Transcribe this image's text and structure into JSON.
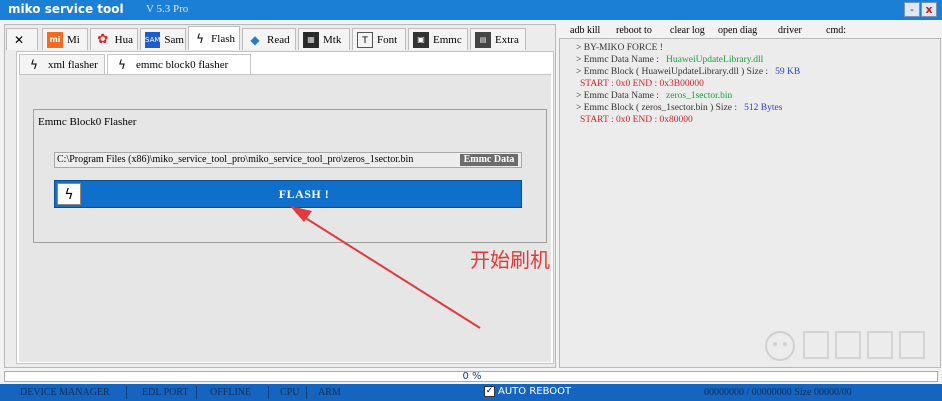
{
  "window": {
    "title": "miko service tool",
    "version": "V 5.3 Pro",
    "minimize_glyph": "-",
    "close_glyph": "x"
  },
  "tabs": [
    {
      "label": "",
      "icon": "tools-icon"
    },
    {
      "label": "Mi",
      "icon": "mi-logo"
    },
    {
      "label": "Hua",
      "icon": "huawei-logo"
    },
    {
      "label": "Sam",
      "icon": "samsung-logo"
    },
    {
      "label": "Flash",
      "icon": "flash-icon"
    },
    {
      "label": "Read",
      "icon": "read-icon"
    },
    {
      "label": "Mtk",
      "icon": "mtk-chip-icon"
    },
    {
      "label": "Font",
      "icon": "font-icon"
    },
    {
      "label": "Emmc",
      "icon": "emmc-chip-icon"
    },
    {
      "label": "Extra",
      "icon": "extra-icon"
    }
  ],
  "subtabs": [
    {
      "label": "xml flasher"
    },
    {
      "label": "emmc block0 flasher"
    }
  ],
  "flasher": {
    "group_title": "Emmc Block0 Flasher",
    "file_path": "C:\\Program Files (x86)\\miko_service_tool_pro\\miko_service_tool_pro\\zeros_1sector.bin",
    "emmc_data_label": "Emmc Data",
    "flash_label": "FLASH !"
  },
  "annotation": {
    "text": "开始刷机",
    "color": "#e03a3a"
  },
  "toolbar": {
    "adb_kill": "adb kill",
    "reboot_to": "reboot to",
    "clear_log": "clear log",
    "open_diag": "open diag",
    "driver": "driver",
    "cmd": "cmd:"
  },
  "log": {
    "line1": "> BY-MIKO FORCE !",
    "line2_label": "> Emmc Data Name :",
    "line2_value": "HuaweiUpdateLibrary.dll",
    "line3_label": "> Emmc Block ( HuaweiUpdateLibrary.dll ) Size :",
    "line3_value": "59 KB",
    "line4": "START : 0x0 END : 0x3B00000",
    "line5_label": "> Emmc Data Name :",
    "line5_value": "zeros_1sector.bin",
    "line6_label": "> Emmc Block ( zeros_1sector.bin ) Size :",
    "line6_value": "512 Bytes",
    "line7": "START : 0x0 END : 0x80000"
  },
  "progress": {
    "value": 0,
    "text": "0 %"
  },
  "statusbar": {
    "device_manager": "DEVICE MANAGER",
    "edl_port": "EDL PORT",
    "offline": "OFFLINE",
    "cpu": "CPU",
    "arm": "ARM",
    "auto_reboot": "AUTO REBOOT",
    "auto_reboot_checked": true,
    "counters": "00000000 / 00000000 Size 00000/00"
  },
  "colors": {
    "title_bar": "#1c7fd6",
    "flash_button": "#0f6fca",
    "status_bar": "#1565c0",
    "log_green": "#1f9a3b",
    "log_red": "#d2252b",
    "log_blue": "#2b3bd4"
  }
}
